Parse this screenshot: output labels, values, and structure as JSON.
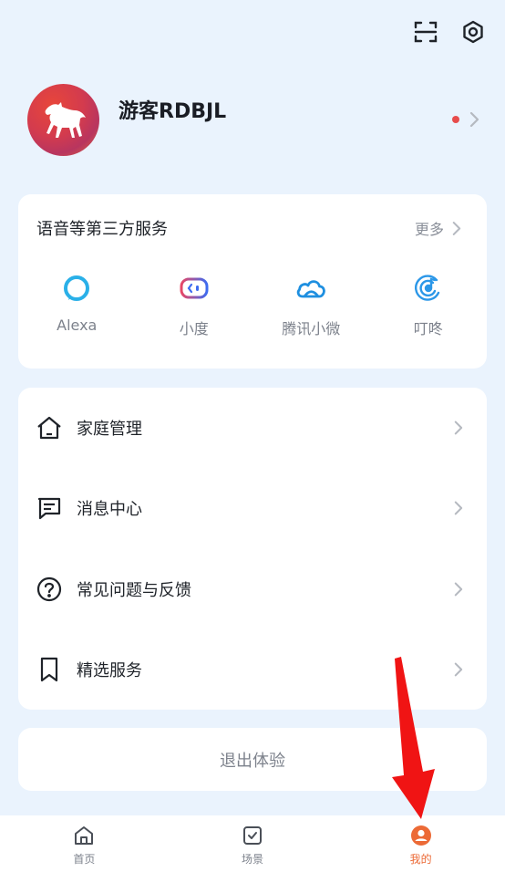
{
  "header": {
    "icons": [
      "scan-icon",
      "settings-icon"
    ]
  },
  "profile": {
    "username": "游客RDBJL",
    "has_notification_dot": true
  },
  "services": {
    "title": "语音等第三方服务",
    "more_label": "更多",
    "items": [
      {
        "label": "Alexa",
        "icon": "alexa-icon"
      },
      {
        "label": "小度",
        "icon": "xiaodu-icon"
      },
      {
        "label": "腾讯小微",
        "icon": "tencent-xiaowei-icon"
      },
      {
        "label": "叮咚",
        "icon": "dingdong-icon"
      }
    ]
  },
  "menu": {
    "items": [
      {
        "label": "家庭管理",
        "icon": "home-icon"
      },
      {
        "label": "消息中心",
        "icon": "message-icon"
      },
      {
        "label": "常见问题与反馈",
        "icon": "help-icon"
      },
      {
        "label": "精选服务",
        "icon": "bookmark-icon"
      }
    ]
  },
  "logout": {
    "label": "退出体验"
  },
  "tabbar": {
    "tabs": [
      {
        "label": "首页",
        "icon": "home-tab-icon",
        "active": false
      },
      {
        "label": "场景",
        "icon": "scene-tab-icon",
        "active": false
      },
      {
        "label": "我的",
        "icon": "profile-tab-icon",
        "active": true
      }
    ]
  },
  "colors": {
    "background": "#eaf3fd",
    "accent": "#ec6a36",
    "annotation_arrow": "#f01414",
    "notification_dot": "#e74c4c"
  }
}
